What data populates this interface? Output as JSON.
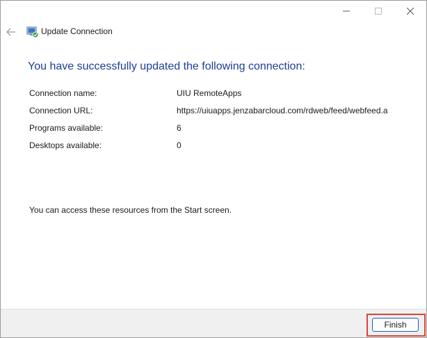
{
  "window": {
    "title": "Update Connection"
  },
  "heading": "You have successfully updated the following connection:",
  "details": [
    {
      "label": "Connection name:",
      "value": "UIU RemoteApps"
    },
    {
      "label": "Connection URL:",
      "value": "https://uiuapps.jenzabarcloud.com/rdweb/feed/webfeed.a"
    },
    {
      "label": "Programs available:",
      "value": "6"
    },
    {
      "label": "Desktops available:",
      "value": "0"
    }
  ],
  "note": "You can access these resources from the Start screen.",
  "footer": {
    "finish_label": "Finish"
  },
  "colors": {
    "heading": "#1b3e94",
    "highlight": "#d9453a",
    "button_border": "#1f5fbf"
  },
  "icons": [
    "minimize-icon",
    "maximize-icon",
    "close-icon",
    "back-arrow-icon",
    "remote-connection-icon"
  ]
}
